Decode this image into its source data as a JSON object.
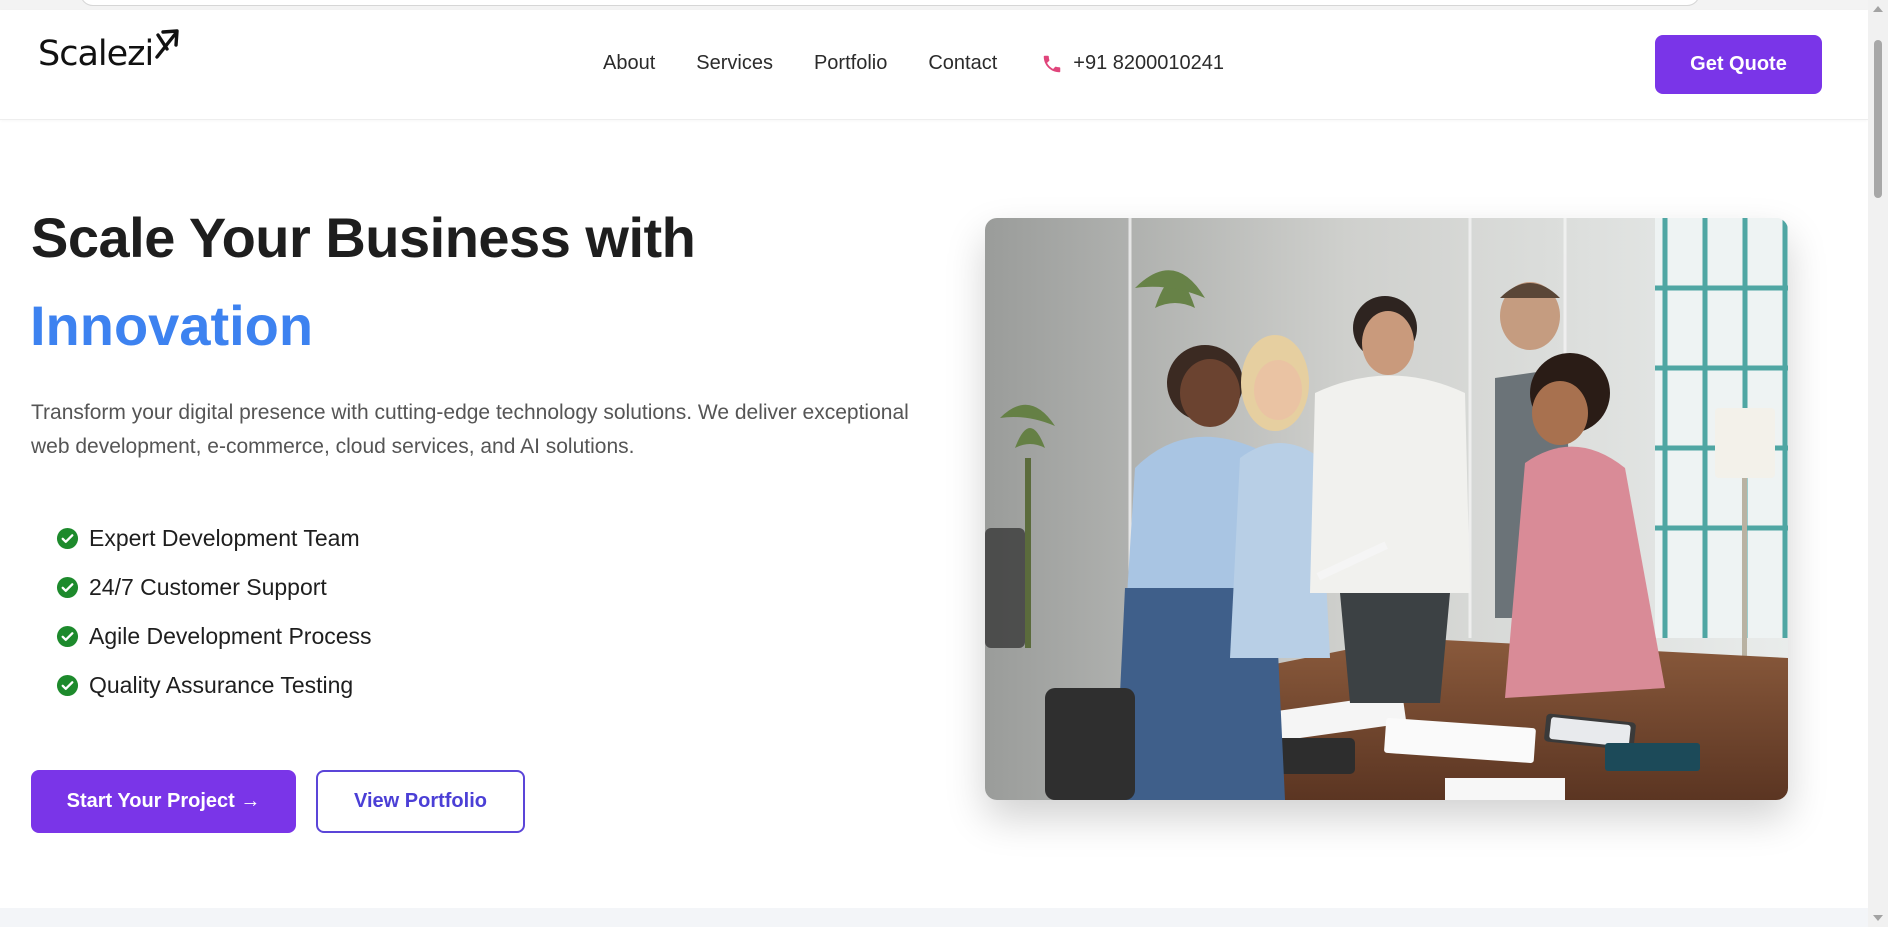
{
  "brand": {
    "logo_text": "Scalezi",
    "accent_color": "#7a35e8",
    "highlight_color": "#3d82f0"
  },
  "nav": {
    "items": [
      {
        "label": "About"
      },
      {
        "label": "Services"
      },
      {
        "label": "Portfolio"
      },
      {
        "label": "Contact"
      }
    ],
    "phone": "+91 8200010241",
    "phone_icon": "phone-icon",
    "cta_label": "Get Quote"
  },
  "hero": {
    "title": "Scale Your Business with",
    "title_accent": "Innovation",
    "description": "Transform your digital presence with cutting-edge technology solutions. We deliver exceptional web development, e-commerce, cloud services, and AI solutions.",
    "features": [
      {
        "label": "Expert Development Team",
        "icon": "check-circle-icon"
      },
      {
        "label": "24/7 Customer Support",
        "icon": "check-circle-icon"
      },
      {
        "label": "Agile Development Process",
        "icon": "check-circle-icon"
      },
      {
        "label": "Quality Assurance Testing",
        "icon": "check-circle-icon"
      }
    ],
    "primary_button": "Start Your Project →",
    "secondary_button": "View Portfolio"
  }
}
